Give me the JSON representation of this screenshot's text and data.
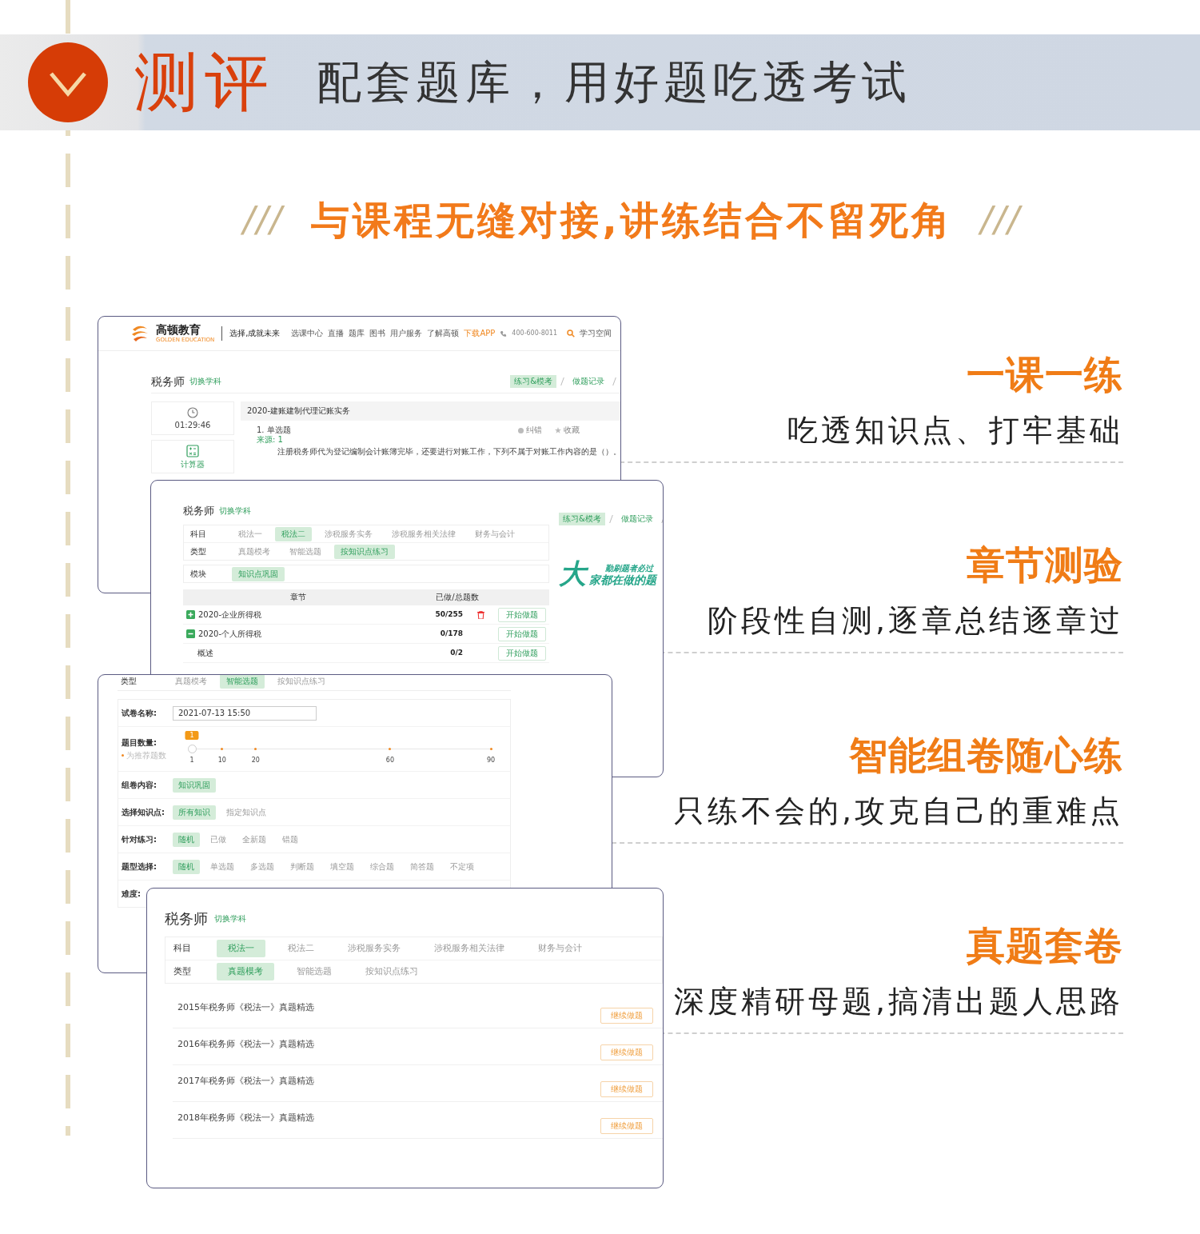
{
  "header": {
    "category": "测评",
    "title": "配套题库，用好题吃透考试"
  },
  "tagline": {
    "left_mark": "///",
    "text": "与课程无缝对接,讲练结合不留死角",
    "right_mark": "///"
  },
  "features": [
    {
      "title": "一课一练",
      "description": "吃透知识点、打牢基础"
    },
    {
      "title": "章节测验",
      "description": "阶段性自测,逐章总结逐章过"
    },
    {
      "title": "智能组卷随心练",
      "description": "只练不会的,攻克自己的重难点"
    },
    {
      "title": "真题套卷",
      "description": "深度精研母题,搞清出题人思路"
    }
  ],
  "screens": [
    {
      "kind": "practice",
      "nav": {
        "brand": "高顿教育",
        "brand_sub": "GOLDEN EDUCATION",
        "slogan": "选择,成就未来",
        "links": [
          {
            "label": "选课中心",
            "highlight": false
          },
          {
            "label": "直播",
            "highlight": false
          },
          {
            "label": "题库",
            "highlight": false
          },
          {
            "label": "图书",
            "highlight": false
          },
          {
            "label": "用户服务",
            "highlight": false
          },
          {
            "label": "了解高顿",
            "highlight": false
          },
          {
            "label": "下载APP",
            "highlight": true
          }
        ],
        "phone": "400-600-8011",
        "account": "学习空间"
      },
      "subject": "税务师",
      "switch_link": "切换学科",
      "tabs": [
        {
          "label": "练习&模考",
          "selected": true
        },
        {
          "label": "做题记录",
          "selected": false
        }
      ],
      "timer": "01:29:46",
      "calculator": "计算器",
      "paper_title": "2020-建账建制代理记账实务",
      "question": {
        "type": "1. 单选题",
        "source": "来源: 1",
        "actions": [
          "纠错",
          "收藏"
        ],
        "text": "注册税务师代为登记编制会计账簿完毕，还要进行对账工作，下列不属于对账工作内容的是（）。"
      }
    },
    {
      "kind": "chapters",
      "subject": "税务师",
      "switch_link": "切换学科",
      "tabs": [
        {
          "label": "练习&模考",
          "selected": true
        },
        {
          "label": "做题记录",
          "selected": false
        }
      ],
      "filter_groups": [
        {
          "filters": [
            {
              "label": "科目",
              "options": [
                {
                  "label": "税法一",
                  "selected": false
                },
                {
                  "label": "税法二",
                  "selected": true
                },
                {
                  "label": "涉税服务实务",
                  "selected": false
                },
                {
                  "label": "涉税服务相关法律",
                  "selected": false
                },
                {
                  "label": "财务与会计",
                  "selected": false
                }
              ]
            },
            {
              "label": "类型",
              "options": [
                {
                  "label": "真题模考",
                  "selected": false
                },
                {
                  "label": "智能选题",
                  "selected": false
                },
                {
                  "label": "按知识点练习",
                  "selected": true
                }
              ]
            }
          ]
        },
        {
          "filters": [
            {
              "label": "模块",
              "options": [
                {
                  "label": "知识点巩固",
                  "selected": true
                }
              ]
            }
          ]
        }
      ],
      "columns": [
        "章节",
        "已做/总题数"
      ],
      "chapters": [
        {
          "name": "2020-企业所得税",
          "count": "50/255",
          "expanded": false,
          "deletable": true,
          "action": "开始做题"
        },
        {
          "name": "2020-个人所得税",
          "count": "0/178",
          "expanded": true,
          "deletable": false,
          "action": "开始做题",
          "children": [
            {
              "name": "概述",
              "count": "0/2",
              "action": "开始做题"
            }
          ]
        }
      ],
      "slogan": {
        "mark": "大",
        "top": "勤刷题者必过",
        "bottom": "家都在做的题"
      }
    },
    {
      "kind": "builder",
      "type_filter": {
        "label": "类型",
        "options": [
          {
            "label": "真题模考",
            "selected": false
          },
          {
            "label": "智能选题",
            "selected": true
          },
          {
            "label": "按知识点练习",
            "selected": false
          }
        ]
      },
      "fields": [
        {
          "kind": "input",
          "label": "试卷名称:",
          "value": "2021-07-13 15:50"
        },
        {
          "kind": "slider",
          "label": "题目数量:",
          "hint": "为推荐题数",
          "level": 0,
          "bubble": "1",
          "ticks": [
            "1",
            "10",
            "20",
            "60",
            "90"
          ]
        },
        {
          "kind": "options",
          "label": "组卷内容:",
          "options": [
            {
              "label": "知识巩固",
              "selected": true
            }
          ]
        },
        {
          "kind": "options",
          "label": "选择知识点:",
          "options": [
            {
              "label": "所有知识",
              "selected": true
            },
            {
              "label": "指定知识点",
              "selected": false
            }
          ]
        },
        {
          "kind": "options",
          "label": "针对练习:",
          "options": [
            {
              "label": "随机",
              "selected": true
            },
            {
              "label": "已做",
              "selected": false
            },
            {
              "label": "全新题",
              "selected": false
            },
            {
              "label": "错题",
              "selected": false
            }
          ]
        },
        {
          "kind": "options",
          "label": "题型选择:",
          "options": [
            {
              "label": "随机",
              "selected": true
            },
            {
              "label": "单选题",
              "selected": false
            },
            {
              "label": "多选题",
              "selected": false
            },
            {
              "label": "判断题",
              "selected": false
            },
            {
              "label": "填空题",
              "selected": false
            },
            {
              "label": "综合题",
              "selected": false
            },
            {
              "label": "简答题",
              "selected": false
            },
            {
              "label": "不定项",
              "selected": false
            }
          ]
        },
        {
          "kind": "label",
          "label": "难度:"
        }
      ]
    },
    {
      "kind": "papers",
      "subject": "税务师",
      "switch_link": "切换学科",
      "filter_groups": [
        {
          "filters": [
            {
              "label": "科目",
              "options": [
                {
                  "label": "税法一",
                  "selected": true
                },
                {
                  "label": "税法二",
                  "selected": false
                },
                {
                  "label": "涉税服务实务",
                  "selected": false
                },
                {
                  "label": "涉税服务相关法律",
                  "selected": false
                },
                {
                  "label": "财务与会计",
                  "selected": false
                }
              ]
            },
            {
              "label": "类型",
              "options": [
                {
                  "label": "真题模考",
                  "selected": true
                },
                {
                  "label": "智能选题",
                  "selected": false
                },
                {
                  "label": "按知识点练习",
                  "selected": false
                }
              ]
            }
          ]
        }
      ],
      "papers": [
        {
          "title": "2015年税务师《税法一》真题精选",
          "action": "继续做题"
        },
        {
          "title": "2016年税务师《税法一》真题精选",
          "action": "继续做题"
        },
        {
          "title": "2017年税务师《税法一》真题精选",
          "action": "继续做题"
        },
        {
          "title": "2018年税务师《税法一》真题精选",
          "action": "继续做题"
        }
      ]
    }
  ]
}
